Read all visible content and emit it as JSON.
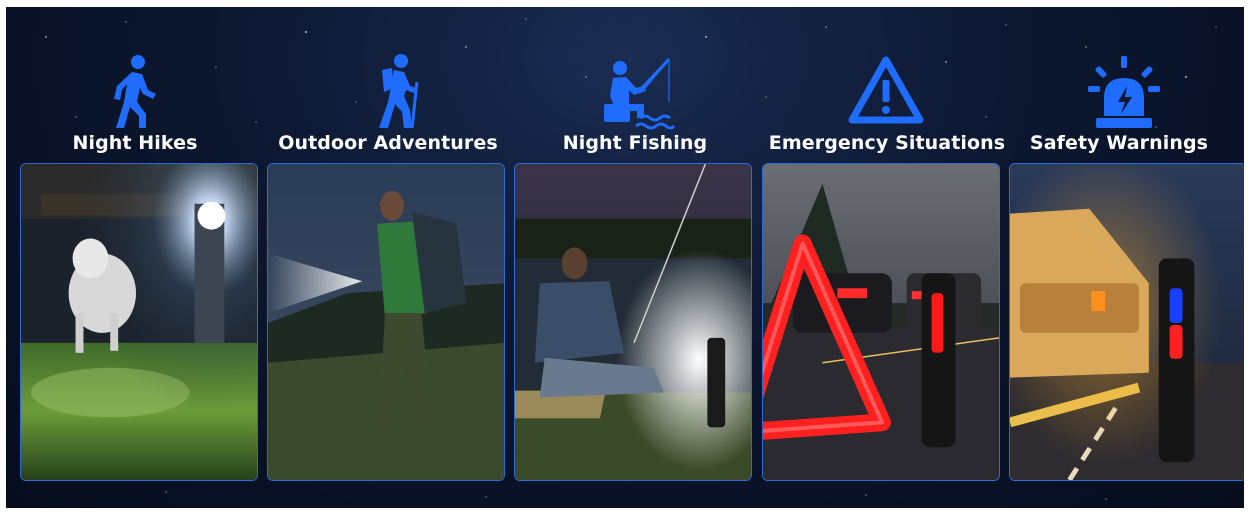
{
  "activities": [
    {
      "label": "Night Hikes",
      "icon": "walking-person-icon"
    },
    {
      "label": "Outdoor Adventures",
      "icon": "hiker-with-stick-icon"
    },
    {
      "label": "Night Fishing",
      "icon": "fishing-person-icon"
    },
    {
      "label": "Emergency Situations",
      "icon": "warning-triangle-icon"
    },
    {
      "label": "Safety Warnings",
      "icon": "siren-light-icon"
    }
  ],
  "colors": {
    "icon_blue": "#1f6cff",
    "panel_border": "#2f6bd8",
    "background": "#0c1730"
  }
}
